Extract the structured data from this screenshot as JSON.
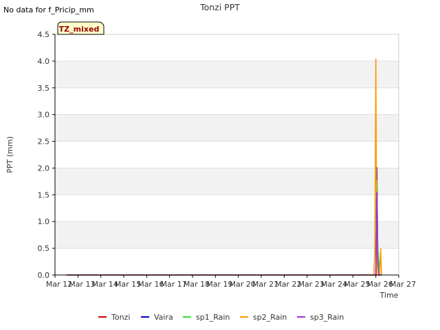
{
  "nodata_note": "No data for f_Pricip_mm",
  "site_badge": "TZ_mixed",
  "chart_data": {
    "type": "line",
    "title": "Tonzi PPT",
    "xlabel": "Time",
    "ylabel": "PPT (mm)",
    "xlim": [
      "2024-03-12",
      "2024-03-27"
    ],
    "ylim": [
      0,
      4.5
    ],
    "x_tick_labels": [
      "Mar 12",
      "Mar 13",
      "Mar 14",
      "Mar 15",
      "Mar 16",
      "Mar 17",
      "Mar 18",
      "Mar 19",
      "Mar 20",
      "Mar 21",
      "Mar 22",
      "Mar 23",
      "Mar 24",
      "Mar 25",
      "Mar 26",
      "Mar 27"
    ],
    "y_ticks": [
      0.0,
      0.5,
      1.0,
      1.5,
      2.0,
      2.5,
      3.0,
      3.5,
      4.0,
      4.5
    ],
    "y_tick_labels": [
      "0.0",
      "0.5",
      "1.0",
      "1.5",
      "2.0",
      "2.5",
      "3.0",
      "3.5",
      "4.0",
      "4.5"
    ],
    "grid": true,
    "legend_position": "bottom",
    "series": [
      {
        "name": "Tonzi",
        "color": "#cc0000",
        "points": [
          [
            "2024-03-12T12:00",
            0
          ],
          [
            "2024-03-26T06:00",
            0
          ]
        ]
      },
      {
        "name": "Vaira",
        "color": "#0000cc",
        "points": [
          [
            "2024-03-12T12:00",
            0
          ],
          [
            "2024-03-26T00:00",
            0
          ],
          [
            "2024-03-26T01:00",
            2.02
          ],
          [
            "2024-03-26T02:00",
            0.5
          ],
          [
            "2024-03-26T03:00",
            0.25
          ],
          [
            "2024-03-26T04:00",
            0
          ],
          [
            "2024-03-26T06:00",
            0
          ]
        ]
      },
      {
        "name": "sp1_Rain",
        "color": "#33dd33",
        "points": [
          [
            "2024-03-12T12:00",
            0
          ],
          [
            "2024-03-26T00:00",
            0
          ],
          [
            "2024-03-26T01:00",
            1.78
          ],
          [
            "2024-03-26T02:00",
            0.5
          ],
          [
            "2024-03-26T03:00",
            0.25
          ],
          [
            "2024-03-26T04:00",
            0
          ],
          [
            "2024-03-26T06:00",
            0
          ]
        ]
      },
      {
        "name": "sp2_Rain",
        "color": "#ff9900",
        "points": [
          [
            "2024-03-12T12:00",
            0
          ],
          [
            "2024-03-25T22:00",
            0
          ],
          [
            "2024-03-25T23:00",
            0.5
          ],
          [
            "2024-03-26T00:00",
            4.05
          ],
          [
            "2024-03-26T01:00",
            0
          ],
          [
            "2024-03-26T04:00",
            0
          ],
          [
            "2024-03-26T05:00",
            0.5
          ],
          [
            "2024-03-26T06:00",
            0
          ]
        ]
      },
      {
        "name": "sp3_Rain",
        "color": "#9933cc",
        "points": [
          [
            "2024-03-12T12:00",
            0
          ],
          [
            "2024-03-26T00:00",
            0
          ],
          [
            "2024-03-26T01:00",
            1.55
          ],
          [
            "2024-03-26T02:00",
            0.25
          ],
          [
            "2024-03-26T03:00",
            0
          ],
          [
            "2024-03-26T06:00",
            0
          ]
        ]
      }
    ]
  }
}
